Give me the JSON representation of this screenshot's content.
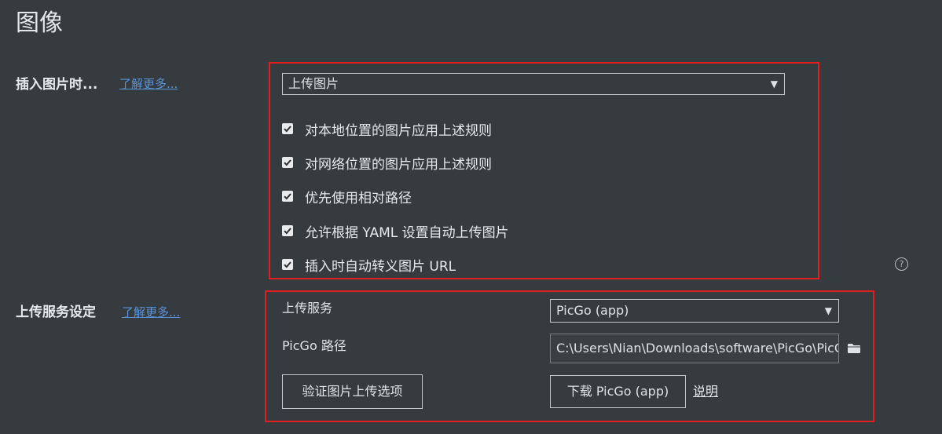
{
  "page": {
    "title": "图像"
  },
  "insert_image": {
    "label": "插入图片时...",
    "learn_more": "了解更多...",
    "action_select": {
      "value": "上传图片"
    },
    "options": [
      {
        "label": "对本地位置的图片应用上述规则",
        "checked": true
      },
      {
        "label": "对网络位置的图片应用上述规则",
        "checked": true
      },
      {
        "label": "优先使用相对路径",
        "checked": true
      },
      {
        "label": "允许根据 YAML 设置自动上传图片",
        "checked": true
      },
      {
        "label": "插入时自动转义图片 URL",
        "checked": true
      }
    ]
  },
  "upload_service": {
    "label": "上传服务设定",
    "learn_more": "了解更多...",
    "service_label": "上传服务",
    "service_select": {
      "value": "PicGo (app)"
    },
    "path_label": "PicGo 路径",
    "path_value": "C:\\Users\\Nian\\Downloads\\software\\PicGo\\PicGo.exe",
    "verify_button": "验证图片上传选项",
    "download_button": "下载 PicGo (app)",
    "doc_link": "说明"
  },
  "icons": {
    "help": "help-circle-icon",
    "folder": "folder-icon",
    "dropdown": "triangle-down-icon",
    "check": "check-icon"
  },
  "colors": {
    "background": "#363b40",
    "highlight_border": "#e02020",
    "link": "#5a93d6",
    "text": "#dfe3e6"
  }
}
